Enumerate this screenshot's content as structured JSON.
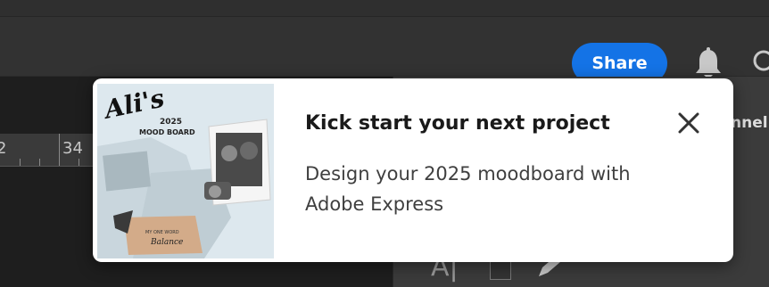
{
  "header": {
    "share_label": "Share"
  },
  "ruler": {
    "labels": [
      "2",
      "34"
    ]
  },
  "side_panel": {
    "tab_label": "nnel",
    "text_tool_glyph": "A|"
  },
  "popup": {
    "title": "Kick start your next project",
    "body": "Design your 2025 moodboard with Adobe Express",
    "thumbnail": {
      "script_title": "Ali's",
      "heading_line1": "2025",
      "heading_line2": "MOOD BOARD",
      "word_label": "MY ONE WORD",
      "word_value": "Balance"
    }
  },
  "icons": {
    "bell": "bell-icon",
    "search": "search-icon",
    "close": "close-icon"
  },
  "colors": {
    "share_button": "#1473e6",
    "popup_background": "#ffffff",
    "app_background": "#323232"
  }
}
